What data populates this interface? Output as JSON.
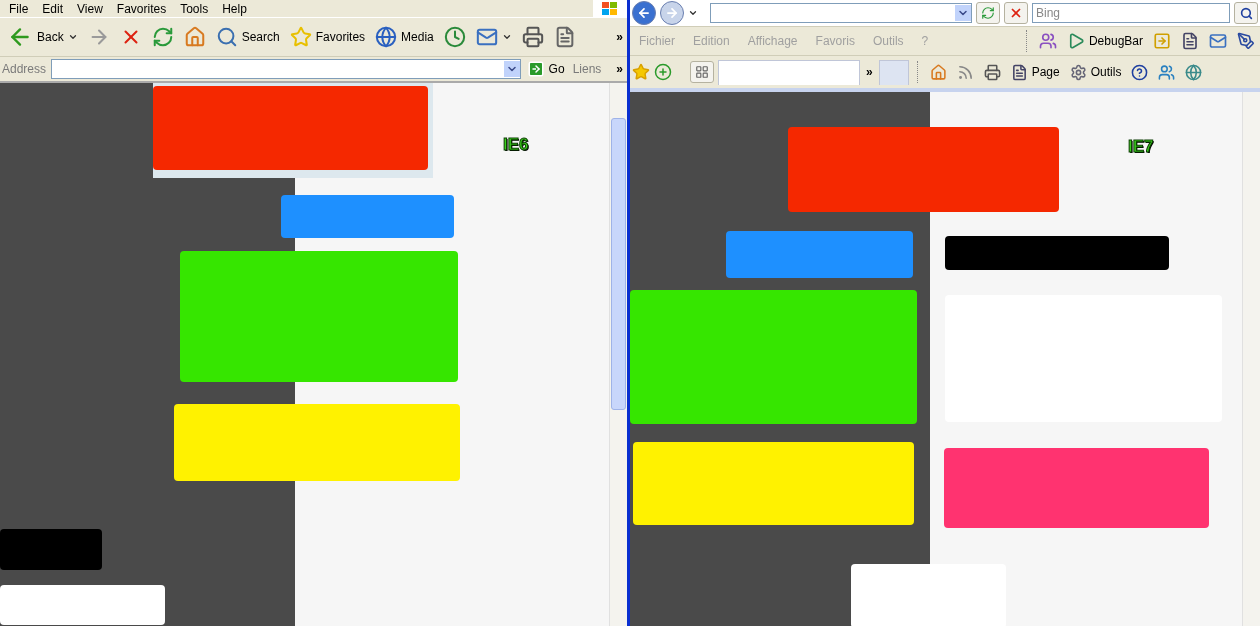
{
  "left": {
    "menu": [
      "File",
      "Edit",
      "View",
      "Favorites",
      "Tools",
      "Help"
    ],
    "toolbar": [
      {
        "kind": "back",
        "label": "Back"
      },
      {
        "kind": "forward"
      },
      {
        "kind": "stop"
      },
      {
        "kind": "refresh"
      },
      {
        "kind": "home"
      },
      {
        "kind": "search",
        "label": "Search"
      },
      {
        "kind": "favorites",
        "label": "Favorites"
      },
      {
        "kind": "media",
        "label": "Media"
      },
      {
        "kind": "history"
      },
      {
        "kind": "mail"
      },
      {
        "kind": "print"
      },
      {
        "kind": "edit"
      }
    ],
    "toolbar_overflow": "»",
    "address_label": "Address",
    "go": "Go",
    "links": "Liens",
    "links_overflow": "»",
    "page_label": "IE6",
    "boxes": [
      {
        "color": "#f52800"
      },
      {
        "color": "#1e90ff"
      },
      {
        "color": "#36e600"
      },
      {
        "color": "#fff200"
      },
      {
        "color": "#000000"
      },
      {
        "color": "#ffffff"
      }
    ]
  },
  "right": {
    "search": {
      "placeholder": "Bing"
    },
    "menu": [
      {
        "label": "Fichier",
        "disabled": true
      },
      {
        "label": "Edition",
        "disabled": true
      },
      {
        "label": "Affichage",
        "disabled": true
      },
      {
        "label": "Favoris",
        "disabled": true
      },
      {
        "label": "Outils",
        "disabled": true
      },
      {
        "label": "?",
        "disabled": true
      }
    ],
    "menu_tools": [
      {
        "kind": "dots"
      },
      {
        "kind": "debugbar",
        "label": "DebugBar"
      },
      {
        "kind": "ie"
      },
      {
        "kind": "page"
      },
      {
        "kind": "mail"
      },
      {
        "kind": "pen"
      }
    ],
    "tab_overflow": "»",
    "command_bar": [
      {
        "kind": "home"
      },
      {
        "kind": "rss"
      },
      {
        "kind": "print"
      },
      {
        "kind": "page",
        "label": "Page"
      },
      {
        "kind": "tools",
        "label": "Outils"
      },
      {
        "kind": "help"
      },
      {
        "kind": "messenger"
      },
      {
        "kind": "research"
      }
    ],
    "page_label": "IE7",
    "boxes": [
      {
        "color": "#f52800"
      },
      {
        "color": "#1e90ff"
      },
      {
        "color": "#000000"
      },
      {
        "color": "#36e600"
      },
      {
        "color": "#ffffff"
      },
      {
        "color": "#fff200"
      },
      {
        "color": "#ff3370"
      },
      {
        "color": "#ffffff"
      }
    ]
  }
}
